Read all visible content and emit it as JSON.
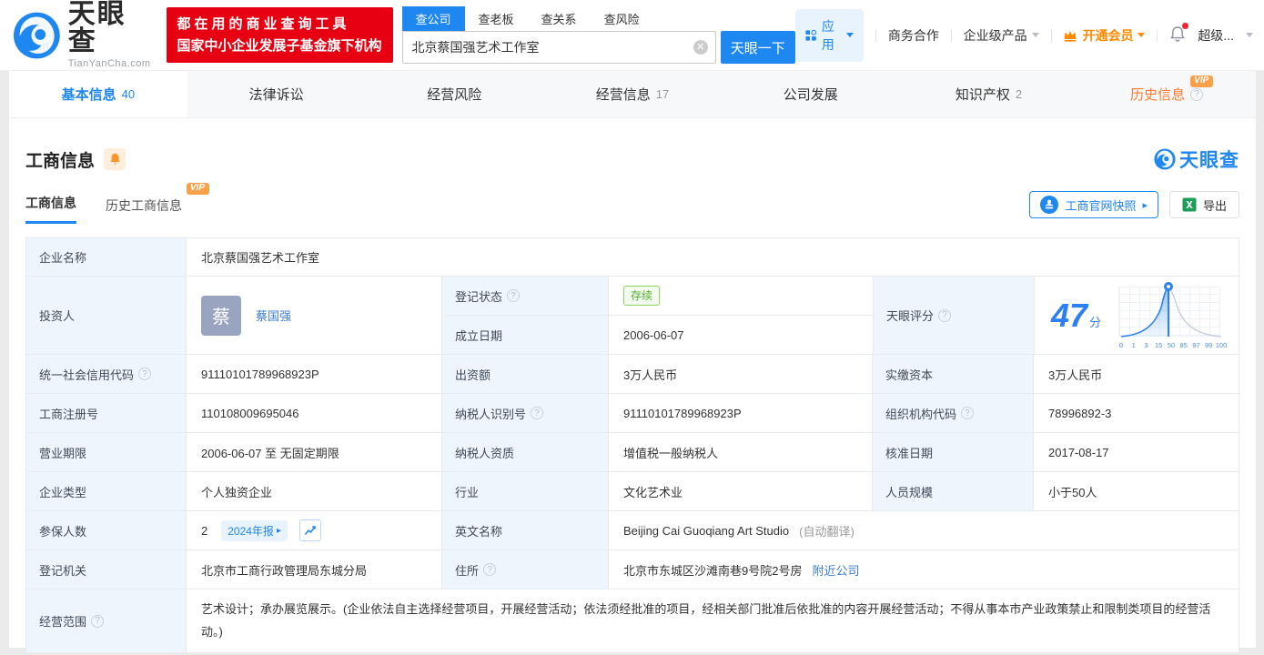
{
  "colors": {
    "brand_blue": "#1e87f0",
    "link_blue": "#3a7bd5",
    "score_blue": "#2e7ff2",
    "vip_orange": "#ff8a00",
    "badge_orange": "#f9a14a",
    "history_orange": "#ff7a30",
    "slogan_red": "#e60012",
    "status_green": "#54ad2e",
    "label_bg": "#eff5fc"
  },
  "header": {
    "logo": {
      "title": "天眼查",
      "subtitle": "TianYanCha.com"
    },
    "slogan": {
      "line1": "都在用的商业查询工具",
      "line2": "国家中小企业发展子基金旗下机构"
    },
    "search": {
      "tabs": [
        {
          "label": "查公司"
        },
        {
          "label": "查老板"
        },
        {
          "label": "查关系"
        },
        {
          "label": "查风险"
        }
      ],
      "value": "北京蔡国强艺术工作室",
      "button": "天眼一下"
    },
    "nav": {
      "apps": "应用",
      "cooperation": "商务合作",
      "enterprise": "企业级产品",
      "vip": "开通会员",
      "super": "超级..."
    }
  },
  "tabs": [
    {
      "label": "基本信息",
      "count": "40"
    },
    {
      "label": "法律诉讼",
      "count": ""
    },
    {
      "label": "经营风险",
      "count": ""
    },
    {
      "label": "经营信息",
      "count": "17"
    },
    {
      "label": "公司发展",
      "count": ""
    },
    {
      "label": "知识产权",
      "count": "2"
    },
    {
      "label": "历史信息",
      "count": "",
      "vip": "VIP"
    }
  ],
  "section": {
    "title": "工商信息",
    "watermark": "天眼查",
    "subtabs": [
      {
        "label": "工商信息"
      },
      {
        "label": "历史工商信息",
        "vip": "VIP"
      }
    ],
    "snapshot_button": "工商官网快照",
    "export_button": "导出",
    "vip_badge": "VIP"
  },
  "table": {
    "company_name": {
      "label": "企业名称",
      "value": "北京蔡国强艺术工作室"
    },
    "investor": {
      "label": "投资人",
      "avatar": "蔡",
      "name": "蔡国强"
    },
    "reg_status": {
      "label": "登记状态",
      "value": "存续"
    },
    "establish_date": {
      "label": "成立日期",
      "value": "2006-06-07"
    },
    "score": {
      "label": "天眼评分",
      "value": "47",
      "unit": "分"
    },
    "credit_code": {
      "label": "统一社会信用代码",
      "value": "91110101789968923P"
    },
    "capital": {
      "label": "出资额",
      "value": "3万人民币"
    },
    "paid_capital": {
      "label": "实缴资本",
      "value": "3万人民币"
    },
    "reg_number": {
      "label": "工商注册号",
      "value": "110108009695046"
    },
    "taxpayer_id": {
      "label": "纳税人识别号",
      "value": "91110101789968923P"
    },
    "org_code": {
      "label": "组织机构代码",
      "value": "78996892-3"
    },
    "business_term": {
      "label": "营业期限",
      "value": "2006-06-07 至 无固定期限"
    },
    "taxpayer_quality": {
      "label": "纳税人资质",
      "value": "增值税一般纳税人"
    },
    "approval_date": {
      "label": "核准日期",
      "value": "2017-08-17"
    },
    "company_type": {
      "label": "企业类型",
      "value": "个人独资企业"
    },
    "industry": {
      "label": "行业",
      "value": "文化艺术业"
    },
    "staff_size": {
      "label": "人员规模",
      "value": "小于50人"
    },
    "insured": {
      "label": "参保人数",
      "value": "2",
      "report_badge": "2024年报"
    },
    "english_name": {
      "label": "英文名称",
      "value": "Beijing Cai Guoqiang Art Studio",
      "note": "(自动翻译)"
    },
    "reg_authority": {
      "label": "登记机关",
      "value": "北京市工商行政管理局东城分局"
    },
    "address": {
      "label": "住所",
      "value": "北京市东城区沙滩南巷9号院2号房",
      "link": "附近公司"
    },
    "business_scope": {
      "label": "经营范围",
      "value": "艺术设计；承办展览展示。(企业依法自主选择经营项目，开展经营活动；依法须经批准的项目，经相关部门批准后依批准的内容开展经营活动；不得从事本市产业政策禁止和限制类项目的经营活动。)"
    }
  },
  "chart_data": {
    "type": "area",
    "title": "天眼评分",
    "score": 47,
    "score_unit": "分",
    "x_ticks": [
      "0",
      "1",
      "3",
      "15",
      "50",
      "85",
      "97",
      "99",
      "100"
    ],
    "curve": "normal-distribution percentile curve, filled blue left of marker",
    "marker_value": 47,
    "xlabel": "",
    "ylabel": "",
    "grid": true,
    "legend": false
  }
}
